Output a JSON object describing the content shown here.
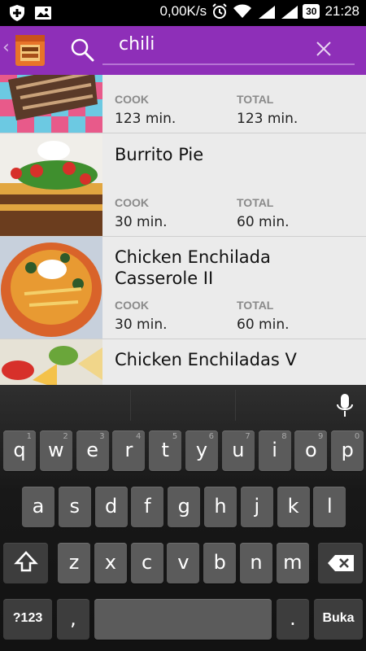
{
  "status_bar": {
    "net_speed": "0,00K/s",
    "battery": "30",
    "time": "21:28"
  },
  "action_bar": {
    "back_glyph": "‹",
    "app_icon": "recipe-book-icon",
    "search_icon": "search-icon",
    "search_query": "chili",
    "clear_icon": "close-icon",
    "color": "#8e2fb8"
  },
  "recipes": [
    {
      "title": "",
      "cook_label": "COOK",
      "cook": "123 min.",
      "total_label": "TOTAL",
      "total": "123 min."
    },
    {
      "title": "Burrito Pie",
      "cook_label": "COOK",
      "cook": "30 min.",
      "total_label": "TOTAL",
      "total": "60 min."
    },
    {
      "title": "Chicken Enchilada Casserole II",
      "cook_label": "COOK",
      "cook": "30 min.",
      "total_label": "TOTAL",
      "total": "60 min."
    },
    {
      "title": "Chicken Enchiladas V",
      "cook_label": "",
      "cook": "",
      "total_label": "",
      "total": ""
    }
  ],
  "keyboard": {
    "row1": [
      {
        "key": "q",
        "hint": "1"
      },
      {
        "key": "w",
        "hint": "2"
      },
      {
        "key": "e",
        "hint": "3"
      },
      {
        "key": "r",
        "hint": "4"
      },
      {
        "key": "t",
        "hint": "5"
      },
      {
        "key": "y",
        "hint": "6"
      },
      {
        "key": "u",
        "hint": "7"
      },
      {
        "key": "i",
        "hint": "8"
      },
      {
        "key": "o",
        "hint": "9"
      },
      {
        "key": "p",
        "hint": "0"
      }
    ],
    "row2": [
      "a",
      "s",
      "d",
      "f",
      "g",
      "h",
      "j",
      "k",
      "l"
    ],
    "row3": [
      "z",
      "x",
      "c",
      "v",
      "b",
      "n",
      "m"
    ],
    "symbols_label": "?123",
    "comma_label": ",",
    "period_label": ".",
    "enter_label": "Buka",
    "shift_icon": "shift-icon",
    "backspace_icon": "backspace-icon",
    "mic_icon": "microphone-icon"
  }
}
